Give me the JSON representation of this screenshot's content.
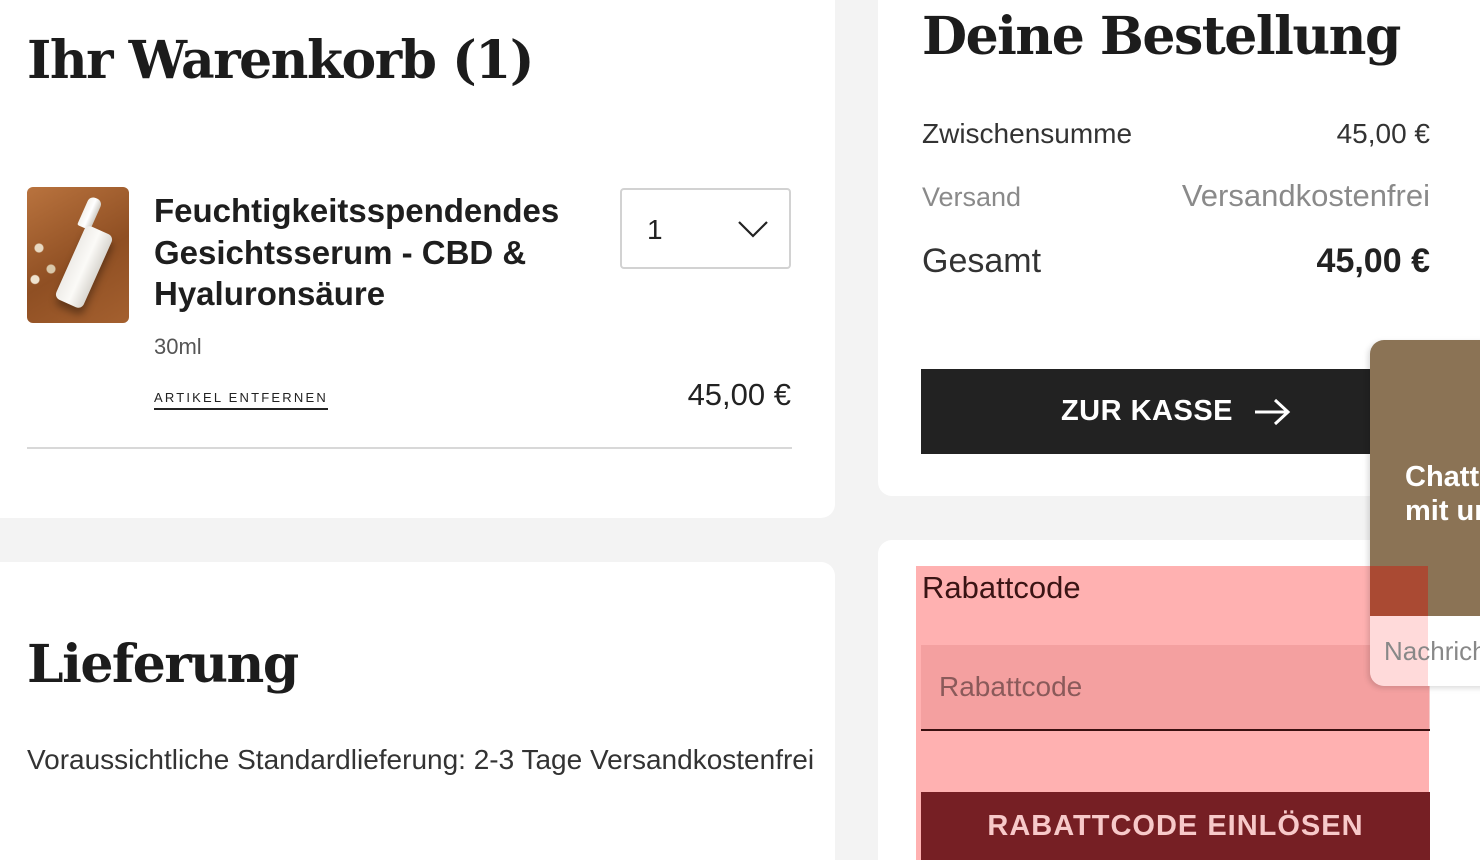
{
  "cart": {
    "title": "Ihr Warenkorb (1)",
    "item": {
      "name": "Feuchtigkeitsspendendes Gesichtsserum - CBD & Hyaluronsäure",
      "variant": "30ml",
      "quantity": "1",
      "price": "45,00 €",
      "remove_label": "ARTIKEL ENTFERNEN"
    }
  },
  "delivery": {
    "title": "Lieferung",
    "text": "Voraussichtliche Standardlieferung: 2-3 Tage Versandkostenfrei"
  },
  "order": {
    "title": "Deine Bestellung",
    "subtotal_label": "Zwischensumme",
    "subtotal_value": "45,00 €",
    "shipping_label": "Versand",
    "shipping_value": "Versandkostenfrei",
    "total_label": "Gesamt",
    "total_value": "45,00 €",
    "checkout_label": "ZUR KASSE"
  },
  "coupon": {
    "label": "Rabattcode",
    "placeholder": "Rabattcode",
    "button_label": "RABATTCODE EINLÖSEN"
  },
  "chat": {
    "title": "Chatten Sie\nmit uns",
    "input_placeholder": "Nachricht"
  },
  "colors": {
    "dark": "#222222",
    "coupon_button": "#761f24",
    "chat_header": "#8b7355",
    "highlight": "#ff7878"
  }
}
